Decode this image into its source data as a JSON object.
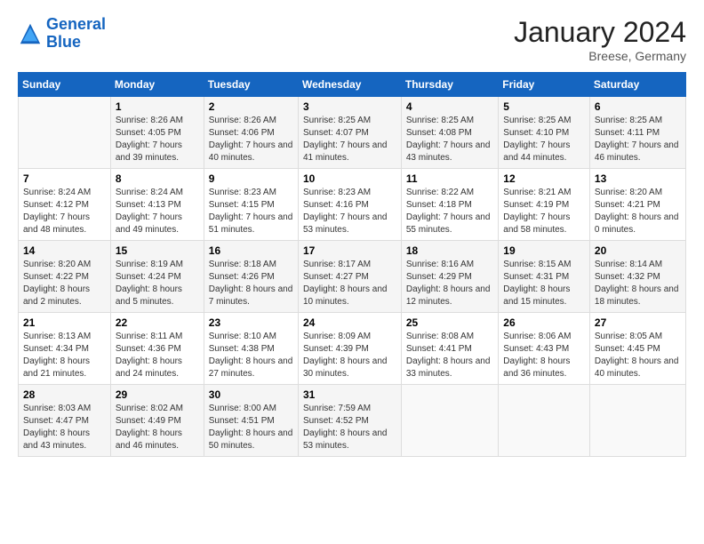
{
  "header": {
    "logo_line1": "General",
    "logo_line2": "Blue",
    "month": "January 2024",
    "location": "Breese, Germany"
  },
  "days_of_week": [
    "Sunday",
    "Monday",
    "Tuesday",
    "Wednesday",
    "Thursday",
    "Friday",
    "Saturday"
  ],
  "weeks": [
    [
      {
        "day": "",
        "sunrise": "",
        "sunset": "",
        "daylight": ""
      },
      {
        "day": "1",
        "sunrise": "Sunrise: 8:26 AM",
        "sunset": "Sunset: 4:05 PM",
        "daylight": "Daylight: 7 hours and 39 minutes."
      },
      {
        "day": "2",
        "sunrise": "Sunrise: 8:26 AM",
        "sunset": "Sunset: 4:06 PM",
        "daylight": "Daylight: 7 hours and 40 minutes."
      },
      {
        "day": "3",
        "sunrise": "Sunrise: 8:25 AM",
        "sunset": "Sunset: 4:07 PM",
        "daylight": "Daylight: 7 hours and 41 minutes."
      },
      {
        "day": "4",
        "sunrise": "Sunrise: 8:25 AM",
        "sunset": "Sunset: 4:08 PM",
        "daylight": "Daylight: 7 hours and 43 minutes."
      },
      {
        "day": "5",
        "sunrise": "Sunrise: 8:25 AM",
        "sunset": "Sunset: 4:10 PM",
        "daylight": "Daylight: 7 hours and 44 minutes."
      },
      {
        "day": "6",
        "sunrise": "Sunrise: 8:25 AM",
        "sunset": "Sunset: 4:11 PM",
        "daylight": "Daylight: 7 hours and 46 minutes."
      }
    ],
    [
      {
        "day": "7",
        "sunrise": "Sunrise: 8:24 AM",
        "sunset": "Sunset: 4:12 PM",
        "daylight": "Daylight: 7 hours and 48 minutes."
      },
      {
        "day": "8",
        "sunrise": "Sunrise: 8:24 AM",
        "sunset": "Sunset: 4:13 PM",
        "daylight": "Daylight: 7 hours and 49 minutes."
      },
      {
        "day": "9",
        "sunrise": "Sunrise: 8:23 AM",
        "sunset": "Sunset: 4:15 PM",
        "daylight": "Daylight: 7 hours and 51 minutes."
      },
      {
        "day": "10",
        "sunrise": "Sunrise: 8:23 AM",
        "sunset": "Sunset: 4:16 PM",
        "daylight": "Daylight: 7 hours and 53 minutes."
      },
      {
        "day": "11",
        "sunrise": "Sunrise: 8:22 AM",
        "sunset": "Sunset: 4:18 PM",
        "daylight": "Daylight: 7 hours and 55 minutes."
      },
      {
        "day": "12",
        "sunrise": "Sunrise: 8:21 AM",
        "sunset": "Sunset: 4:19 PM",
        "daylight": "Daylight: 7 hours and 58 minutes."
      },
      {
        "day": "13",
        "sunrise": "Sunrise: 8:20 AM",
        "sunset": "Sunset: 4:21 PM",
        "daylight": "Daylight: 8 hours and 0 minutes."
      }
    ],
    [
      {
        "day": "14",
        "sunrise": "Sunrise: 8:20 AM",
        "sunset": "Sunset: 4:22 PM",
        "daylight": "Daylight: 8 hours and 2 minutes."
      },
      {
        "day": "15",
        "sunrise": "Sunrise: 8:19 AM",
        "sunset": "Sunset: 4:24 PM",
        "daylight": "Daylight: 8 hours and 5 minutes."
      },
      {
        "day": "16",
        "sunrise": "Sunrise: 8:18 AM",
        "sunset": "Sunset: 4:26 PM",
        "daylight": "Daylight: 8 hours and 7 minutes."
      },
      {
        "day": "17",
        "sunrise": "Sunrise: 8:17 AM",
        "sunset": "Sunset: 4:27 PM",
        "daylight": "Daylight: 8 hours and 10 minutes."
      },
      {
        "day": "18",
        "sunrise": "Sunrise: 8:16 AM",
        "sunset": "Sunset: 4:29 PM",
        "daylight": "Daylight: 8 hours and 12 minutes."
      },
      {
        "day": "19",
        "sunrise": "Sunrise: 8:15 AM",
        "sunset": "Sunset: 4:31 PM",
        "daylight": "Daylight: 8 hours and 15 minutes."
      },
      {
        "day": "20",
        "sunrise": "Sunrise: 8:14 AM",
        "sunset": "Sunset: 4:32 PM",
        "daylight": "Daylight: 8 hours and 18 minutes."
      }
    ],
    [
      {
        "day": "21",
        "sunrise": "Sunrise: 8:13 AM",
        "sunset": "Sunset: 4:34 PM",
        "daylight": "Daylight: 8 hours and 21 minutes."
      },
      {
        "day": "22",
        "sunrise": "Sunrise: 8:11 AM",
        "sunset": "Sunset: 4:36 PM",
        "daylight": "Daylight: 8 hours and 24 minutes."
      },
      {
        "day": "23",
        "sunrise": "Sunrise: 8:10 AM",
        "sunset": "Sunset: 4:38 PM",
        "daylight": "Daylight: 8 hours and 27 minutes."
      },
      {
        "day": "24",
        "sunrise": "Sunrise: 8:09 AM",
        "sunset": "Sunset: 4:39 PM",
        "daylight": "Daylight: 8 hours and 30 minutes."
      },
      {
        "day": "25",
        "sunrise": "Sunrise: 8:08 AM",
        "sunset": "Sunset: 4:41 PM",
        "daylight": "Daylight: 8 hours and 33 minutes."
      },
      {
        "day": "26",
        "sunrise": "Sunrise: 8:06 AM",
        "sunset": "Sunset: 4:43 PM",
        "daylight": "Daylight: 8 hours and 36 minutes."
      },
      {
        "day": "27",
        "sunrise": "Sunrise: 8:05 AM",
        "sunset": "Sunset: 4:45 PM",
        "daylight": "Daylight: 8 hours and 40 minutes."
      }
    ],
    [
      {
        "day": "28",
        "sunrise": "Sunrise: 8:03 AM",
        "sunset": "Sunset: 4:47 PM",
        "daylight": "Daylight: 8 hours and 43 minutes."
      },
      {
        "day": "29",
        "sunrise": "Sunrise: 8:02 AM",
        "sunset": "Sunset: 4:49 PM",
        "daylight": "Daylight: 8 hours and 46 minutes."
      },
      {
        "day": "30",
        "sunrise": "Sunrise: 8:00 AM",
        "sunset": "Sunset: 4:51 PM",
        "daylight": "Daylight: 8 hours and 50 minutes."
      },
      {
        "day": "31",
        "sunrise": "Sunrise: 7:59 AM",
        "sunset": "Sunset: 4:52 PM",
        "daylight": "Daylight: 8 hours and 53 minutes."
      },
      {
        "day": "",
        "sunrise": "",
        "sunset": "",
        "daylight": ""
      },
      {
        "day": "",
        "sunrise": "",
        "sunset": "",
        "daylight": ""
      },
      {
        "day": "",
        "sunrise": "",
        "sunset": "",
        "daylight": ""
      }
    ]
  ]
}
